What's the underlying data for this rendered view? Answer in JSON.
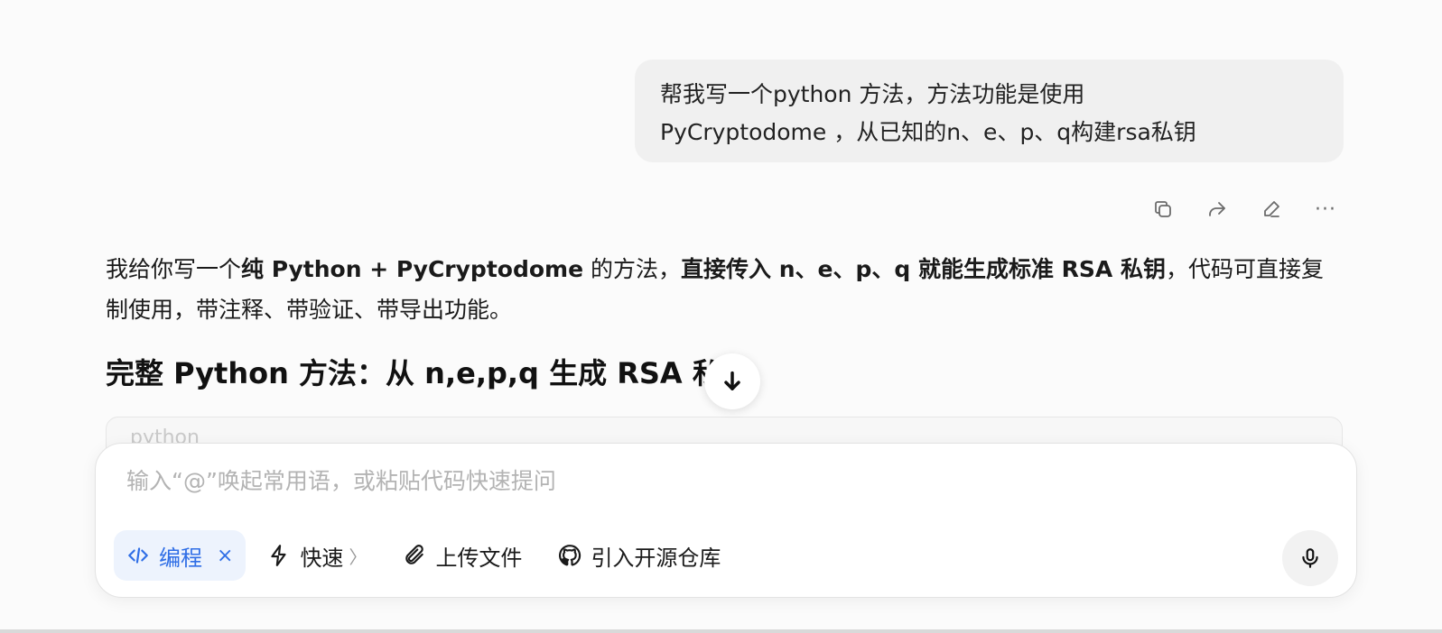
{
  "user_message": {
    "line1": "帮我写一个python  方法，方法功能是使用",
    "line2": "PyCryptodome ，从已知的n、e、p、q构建rsa私钥"
  },
  "message_actions": [
    {
      "name": "copy-icon"
    },
    {
      "name": "share-icon"
    },
    {
      "name": "edit-icon"
    },
    {
      "name": "more-icon",
      "glyph": "···"
    }
  ],
  "answer": {
    "p1_a": "我给你写一个",
    "p1_b": "纯 Python + PyCryptodome",
    "p1_c": " 的方法，",
    "p1_d": "直接传入 n、e、p、q 就能生成标准 RSA 私钥",
    "p1_e": "，代码可直接复制使用，带注释、带验证、带导出功能。",
    "heading": "完整 Python 方法：从 n,e,p,q 生成 RSA 私钥",
    "code_lang": "python"
  },
  "composer": {
    "placeholder": "输入“@”唤起常用语，或粘贴代码快速提问",
    "mode_label": "编程",
    "mode_close": "×",
    "speed_label": "快速",
    "speed_chevron": "〉",
    "upload_label": "上传文件",
    "repo_label": "引入开源仓库"
  },
  "colors": {
    "accent": "#2f6ee6",
    "accent_bg": "#edf3fd",
    "bubble_bg": "#f0f0f0",
    "placeholder": "#b3b3b3"
  }
}
